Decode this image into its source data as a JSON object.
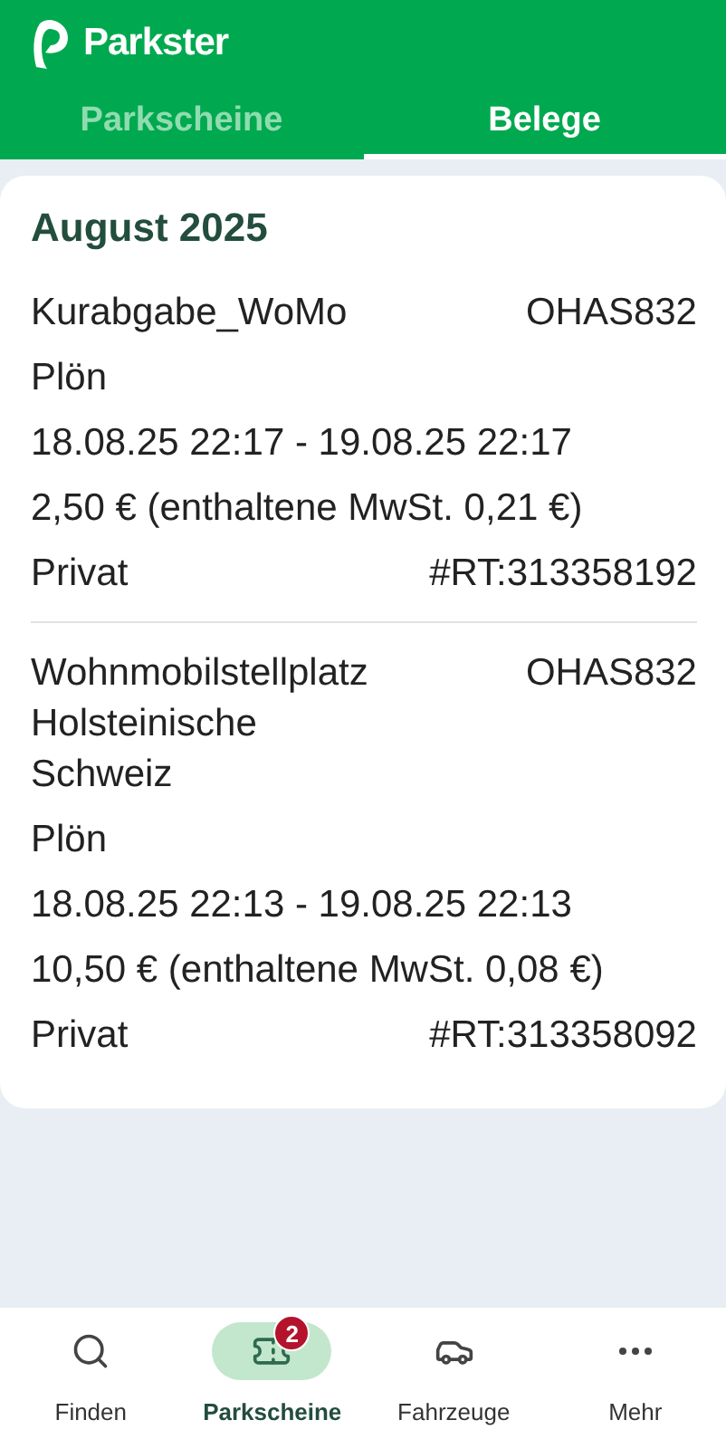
{
  "app": {
    "name": "Parkster"
  },
  "tabs": [
    {
      "label": "Parkscheine",
      "selected": false
    },
    {
      "label": "Belege",
      "selected": true
    }
  ],
  "month": "August 2025",
  "receipts": [
    {
      "title": "Kurabgabe_WoMo",
      "plate": "OHAS832",
      "city": "Plön",
      "period": "18.08.25 22:17 - 19.08.25 22:17",
      "price": "2,50 € (enthaltene MwSt. 0,21 €)",
      "type": "Privat",
      "reference": "#RT:313358192"
    },
    {
      "title": "Wohnmobilstellplatz Holsteinische Schweiz",
      "plate": "OHAS832",
      "city": "Plön",
      "period": "18.08.25 22:13 - 19.08.25 22:13",
      "price": "10,50 € (enthaltene MwSt. 0,08 €)",
      "type": "Privat",
      "reference": "#RT:313358092"
    }
  ],
  "nav": [
    {
      "label": "Finden",
      "kind": "search",
      "selected": false
    },
    {
      "label": "Parkscheine",
      "kind": "ticket",
      "selected": true,
      "badge": "2"
    },
    {
      "label": "Fahrzeuge",
      "kind": "car",
      "selected": false
    },
    {
      "label": "Mehr",
      "kind": "more",
      "selected": false
    }
  ]
}
